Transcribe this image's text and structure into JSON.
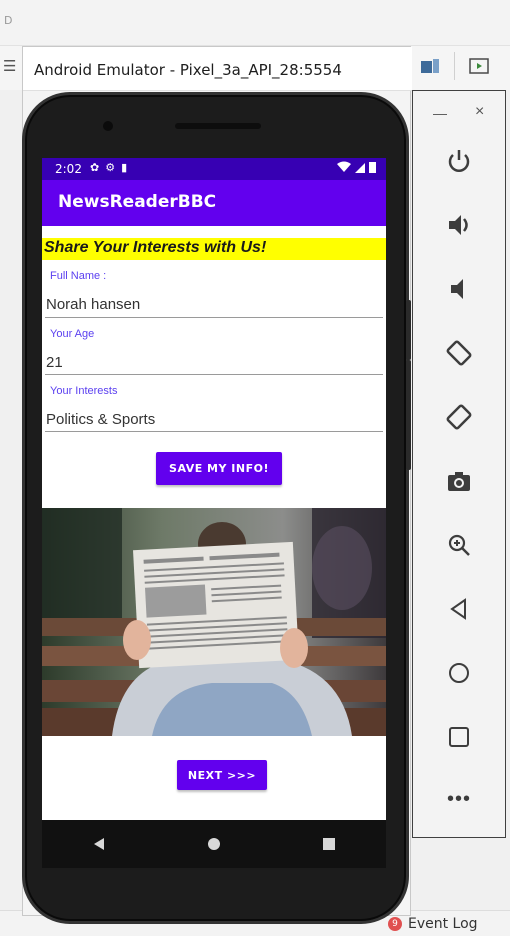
{
  "ide": {
    "dim_label": "D",
    "event_log": "Event Log",
    "event_badge": "9"
  },
  "emulator": {
    "title": "Android Emulator - Pixel_3a_API_28:5554"
  },
  "status_bar": {
    "time": "2:02"
  },
  "app": {
    "title": "NewsReaderBBC",
    "headline": "Share Your Interests with Us!",
    "fields": [
      {
        "label": "Full Name :",
        "value": "Norah hansen"
      },
      {
        "label": "Your Age",
        "value": "21"
      },
      {
        "label": "Your Interests",
        "value": "Politics & Sports"
      }
    ],
    "save_button": "SAVE MY INFO!",
    "next_button": "NEXT >>>"
  },
  "tools": {
    "more": "•••"
  },
  "colors": {
    "primary": "#6200ee",
    "primary_dark": "#3700b3",
    "headline_bg": "#ffff00",
    "label": "#5b40f0"
  }
}
